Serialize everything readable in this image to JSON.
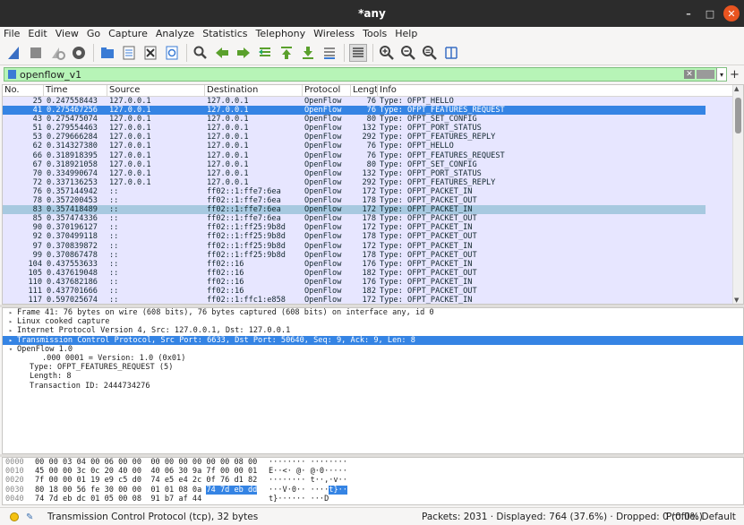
{
  "window": {
    "title": "*any"
  },
  "menu": [
    "File",
    "Edit",
    "View",
    "Go",
    "Capture",
    "Analyze",
    "Statistics",
    "Telephony",
    "Wireless",
    "Tools",
    "Help"
  ],
  "toolbar_icons": [
    "shark-fin-icon",
    "stop-icon",
    "restart-icon",
    "options-icon",
    "open-icon",
    "save-icon",
    "close-file-icon",
    "reload-icon",
    "find-icon",
    "back-icon",
    "forward-icon",
    "goto-icon",
    "first-icon",
    "last-icon",
    "autoscroll-icon",
    "colorize-icon",
    "zoom-in-icon",
    "zoom-out-icon",
    "zoom-reset-icon",
    "resize-columns-icon"
  ],
  "filter": {
    "value": "openflow_v1",
    "accent": "#b7f4b7"
  },
  "columns": [
    "No.",
    "Time",
    "Source",
    "Destination",
    "Protocol",
    "Length",
    "Info"
  ],
  "packets": [
    {
      "no": "25",
      "time": "0.247558443",
      "src": "127.0.0.1",
      "dst": "127.0.0.1",
      "proto": "OpenFlow",
      "len": "76",
      "info": "Type: OFPT_HELLO",
      "state": "normal"
    },
    {
      "no": "41",
      "time": "0.275467256",
      "src": "127.0.0.1",
      "dst": "127.0.0.1",
      "proto": "OpenFlow",
      "len": "76",
      "info": "Type: OFPT_FEATURES_REQUEST",
      "state": "selected"
    },
    {
      "no": "43",
      "time": "0.275475074",
      "src": "127.0.0.1",
      "dst": "127.0.0.1",
      "proto": "OpenFlow",
      "len": "80",
      "info": "Type: OFPT_SET_CONFIG",
      "state": "normal"
    },
    {
      "no": "51",
      "time": "0.279554463",
      "src": "127.0.0.1",
      "dst": "127.0.0.1",
      "proto": "OpenFlow",
      "len": "132",
      "info": "Type: OFPT_PORT_STATUS",
      "state": "normal"
    },
    {
      "no": "53",
      "time": "0.279666284",
      "src": "127.0.0.1",
      "dst": "127.0.0.1",
      "proto": "OpenFlow",
      "len": "292",
      "info": "Type: OFPT_FEATURES_REPLY",
      "state": "normal"
    },
    {
      "no": "62",
      "time": "0.314327380",
      "src": "127.0.0.1",
      "dst": "127.0.0.1",
      "proto": "OpenFlow",
      "len": "76",
      "info": "Type: OFPT_HELLO",
      "state": "normal"
    },
    {
      "no": "66",
      "time": "0.318918395",
      "src": "127.0.0.1",
      "dst": "127.0.0.1",
      "proto": "OpenFlow",
      "len": "76",
      "info": "Type: OFPT_FEATURES_REQUEST",
      "state": "normal"
    },
    {
      "no": "67",
      "time": "0.318921058",
      "src": "127.0.0.1",
      "dst": "127.0.0.1",
      "proto": "OpenFlow",
      "len": "80",
      "info": "Type: OFPT_SET_CONFIG",
      "state": "normal"
    },
    {
      "no": "70",
      "time": "0.334990674",
      "src": "127.0.0.1",
      "dst": "127.0.0.1",
      "proto": "OpenFlow",
      "len": "132",
      "info": "Type: OFPT_PORT_STATUS",
      "state": "normal"
    },
    {
      "no": "72",
      "time": "0.337136253",
      "src": "127.0.0.1",
      "dst": "127.0.0.1",
      "proto": "OpenFlow",
      "len": "292",
      "info": "Type: OFPT_FEATURES_REPLY",
      "state": "normal"
    },
    {
      "no": "76",
      "time": "0.357144942",
      "src": "::",
      "dst": "ff02::1:ffe7:6ea",
      "proto": "OpenFlow",
      "len": "172",
      "info": "Type: OFPT_PACKET_IN",
      "state": "normal"
    },
    {
      "no": "78",
      "time": "0.357200453",
      "src": "::",
      "dst": "ff02::1:ffe7:6ea",
      "proto": "OpenFlow",
      "len": "178",
      "info": "Type: OFPT_PACKET_OUT",
      "state": "normal"
    },
    {
      "no": "83",
      "time": "0.357418489",
      "src": "::",
      "dst": "ff02::1:ffe7:6ea",
      "proto": "OpenFlow",
      "len": "172",
      "info": "Type: OFPT_PACKET_IN",
      "state": "marked"
    },
    {
      "no": "85",
      "time": "0.357474336",
      "src": "::",
      "dst": "ff02::1:ffe7:6ea",
      "proto": "OpenFlow",
      "len": "178",
      "info": "Type: OFPT_PACKET_OUT",
      "state": "normal"
    },
    {
      "no": "90",
      "time": "0.370196127",
      "src": "::",
      "dst": "ff02::1:ff25:9b8d",
      "proto": "OpenFlow",
      "len": "172",
      "info": "Type: OFPT_PACKET_IN",
      "state": "normal"
    },
    {
      "no": "92",
      "time": "0.370499118",
      "src": "::",
      "dst": "ff02::1:ff25:9b8d",
      "proto": "OpenFlow",
      "len": "178",
      "info": "Type: OFPT_PACKET_OUT",
      "state": "normal"
    },
    {
      "no": "97",
      "time": "0.370839872",
      "src": "::",
      "dst": "ff02::1:ff25:9b8d",
      "proto": "OpenFlow",
      "len": "172",
      "info": "Type: OFPT_PACKET_IN",
      "state": "normal"
    },
    {
      "no": "99",
      "time": "0.370867478",
      "src": "::",
      "dst": "ff02::1:ff25:9b8d",
      "proto": "OpenFlow",
      "len": "178",
      "info": "Type: OFPT_PACKET_OUT",
      "state": "normal"
    },
    {
      "no": "104",
      "time": "0.437553633",
      "src": "::",
      "dst": "ff02::16",
      "proto": "OpenFlow",
      "len": "176",
      "info": "Type: OFPT_PACKET_IN",
      "state": "normal"
    },
    {
      "no": "105",
      "time": "0.437619048",
      "src": "::",
      "dst": "ff02::16",
      "proto": "OpenFlow",
      "len": "182",
      "info": "Type: OFPT_PACKET_OUT",
      "state": "normal"
    },
    {
      "no": "110",
      "time": "0.437682186",
      "src": "::",
      "dst": "ff02::16",
      "proto": "OpenFlow",
      "len": "176",
      "info": "Type: OFPT_PACKET_IN",
      "state": "normal"
    },
    {
      "no": "111",
      "time": "0.437701666",
      "src": "::",
      "dst": "ff02::16",
      "proto": "OpenFlow",
      "len": "182",
      "info": "Type: OFPT_PACKET_OUT",
      "state": "normal"
    },
    {
      "no": "117",
      "time": "0.597025674",
      "src": "::",
      "dst": "ff02::1:ffc1:e858",
      "proto": "OpenFlow",
      "len": "172",
      "info": "Type: OFPT_PACKET_IN",
      "state": "normal"
    }
  ],
  "details": [
    {
      "text": "Frame 41: 76 bytes on wire (608 bits), 76 bytes captured (608 bits) on interface any, id 0",
      "twisty": "▸",
      "indent": 0,
      "selected": false
    },
    {
      "text": "Linux cooked capture",
      "twisty": "▸",
      "indent": 0,
      "selected": false
    },
    {
      "text": "Internet Protocol Version 4, Src: 127.0.0.1, Dst: 127.0.0.1",
      "twisty": "▸",
      "indent": 0,
      "selected": false
    },
    {
      "text": "Transmission Control Protocol, Src Port: 6633, Dst Port: 50640, Seq: 9, Ack: 9, Len: 8",
      "twisty": "▸",
      "indent": 0,
      "selected": true
    },
    {
      "text": "OpenFlow 1.0",
      "twisty": "▾",
      "indent": 0,
      "selected": false
    },
    {
      "text": ".000 0001 = Version: 1.0 (0x01)",
      "twisty": "",
      "indent": 2,
      "selected": false
    },
    {
      "text": "Type: OFPT_FEATURES_REQUEST (5)",
      "twisty": "",
      "indent": 1,
      "selected": false
    },
    {
      "text": "Length: 8",
      "twisty": "",
      "indent": 1,
      "selected": false
    },
    {
      "text": "Transaction ID: 2444734276",
      "twisty": "",
      "indent": 1,
      "selected": false
    }
  ],
  "bytes": [
    {
      "off": "0000",
      "hex": "00 00 03 04 00 06 00 00  00 00 00 00 00 00 08 00",
      "hl_start": -1,
      "hl_end": -1,
      "ascii": "········ ········",
      "ascii_hl": ""
    },
    {
      "off": "0010",
      "hex": "45 00 00 3c 0c 20 40 00  40 06 30 9a 7f 00 00 01",
      "hl_start": -1,
      "hl_end": -1,
      "ascii": "E··<· @· @·0·····",
      "ascii_hl": ""
    },
    {
      "off": "0020",
      "hex": "7f 00 00 01 19 e9 c5 d0  74 e5 e4 2c 0f 76 d1 82",
      "hl_start": -1,
      "hl_end": -1,
      "ascii": "········ t··,·v··",
      "ascii_hl": ""
    },
    {
      "off": "0030",
      "hex": "80 18 00 56 fe 30 00 00  01 01 08 0a 74 7d eb dd",
      "hl_pre": "80 18 00 56 fe 30 00 00  01 01 08 0a ",
      "hl_text": "74 7d eb dd",
      "ascii": "···V·0·· ····",
      "ascii_hl": "t}··"
    },
    {
      "off": "0040",
      "hex": "74 7d eb dc 01 05 00 08  91 b7 af 44",
      "hl_start": -1,
      "hl_end": -1,
      "ascii": "t}······ ···D",
      "ascii_hl": ""
    }
  ],
  "status": {
    "message": "Transmission Control Protocol (tcp), 32 bytes",
    "packets": "Packets: 2031 · Displayed: 764 (37.6%) · Dropped: 0 (0.0%)",
    "profile": "Profile: Default"
  }
}
